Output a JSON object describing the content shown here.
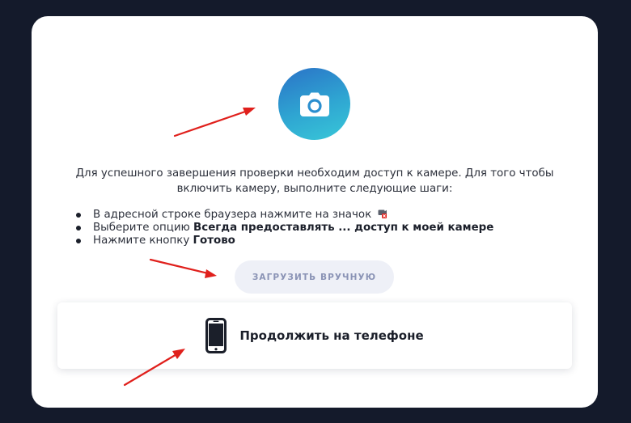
{
  "permission_card": {
    "intro_text": "Для успешного завершения проверки необходим доступ к камере. Для того чтобы включить камеру, выполните следующие шаги:",
    "steps": [
      {
        "text": "В адресной строке браузера нажмите на значок",
        "bold": ""
      },
      {
        "text": "Выберите опцию ",
        "bold": "Всегда предоставлять ... доступ к моей камере"
      },
      {
        "text": "Нажмите кнопку ",
        "bold": "Готово"
      }
    ],
    "upload_button_label": "ЗАГРУЗИТЬ ВРУЧНУЮ",
    "phone_button_label": "Продолжить на телефоне"
  },
  "icons": {
    "camera": "camera-icon",
    "site_permission": "camera-blocked-icon",
    "phone": "smartphone-icon",
    "annotation_arrows": "red-arrow-icon"
  },
  "colors": {
    "page_background": "#141a2b",
    "card_background": "#ffffff",
    "camera_gradient_start": "#2a72c7",
    "camera_gradient_end": "#38c8d8",
    "upload_button_bg": "#eef0f7",
    "upload_button_text": "#8a93b5",
    "annotation_arrow": "#e0201c"
  }
}
